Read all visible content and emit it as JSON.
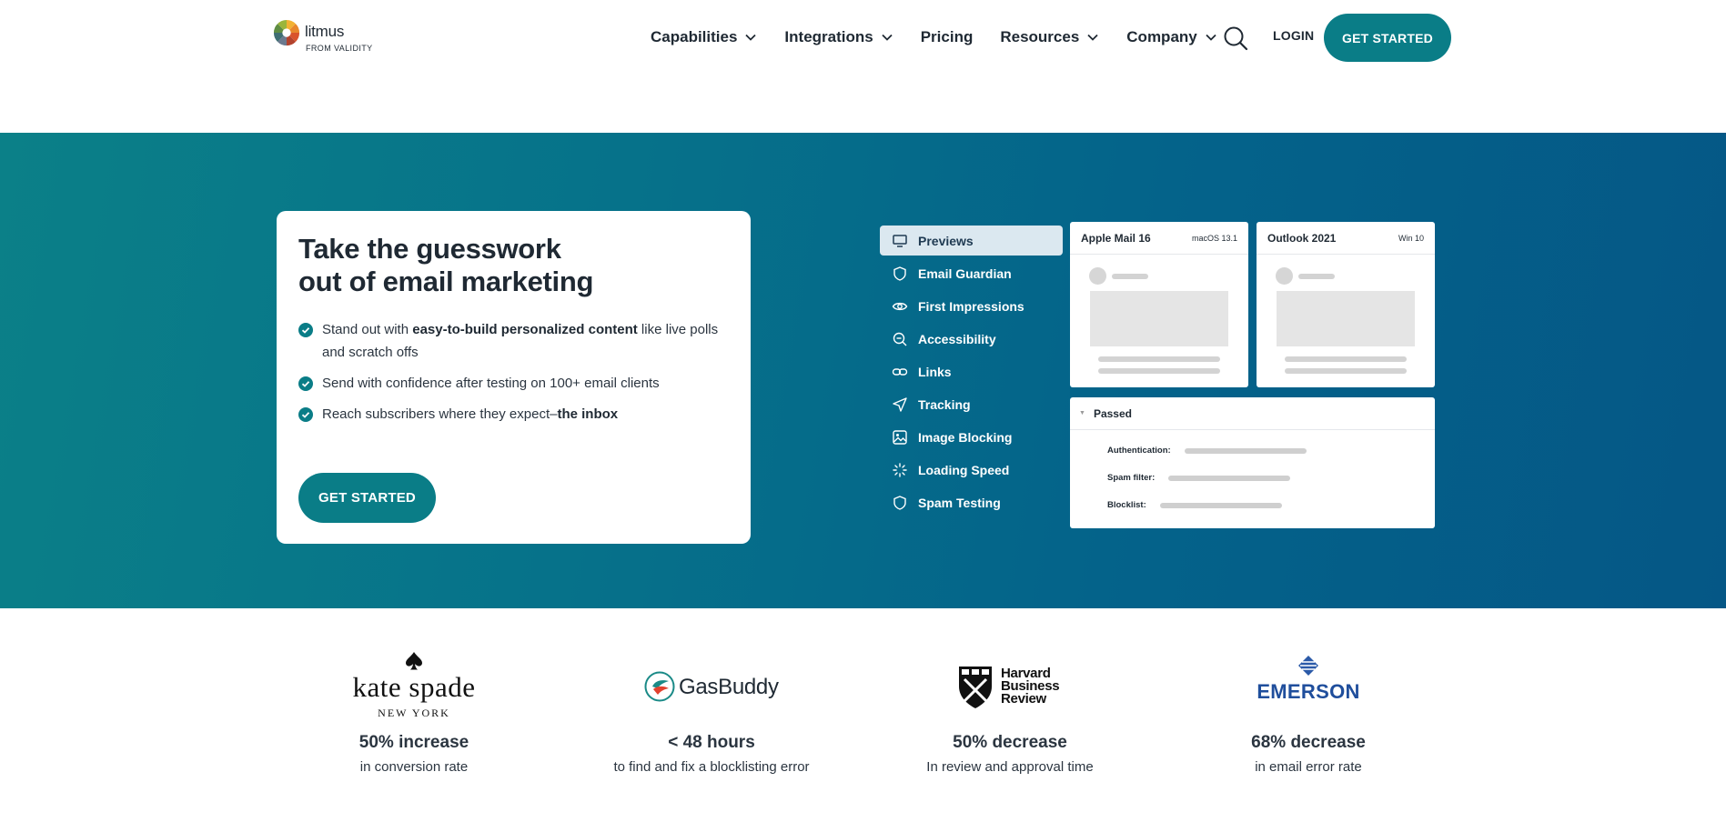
{
  "header": {
    "logo_word": "litmus",
    "logo_sub": "FROM VALIDITY",
    "nav": [
      {
        "label": "Capabilities",
        "has_dropdown": true
      },
      {
        "label": "Integrations",
        "has_dropdown": true
      },
      {
        "label": "Pricing",
        "has_dropdown": false
      },
      {
        "label": "Resources",
        "has_dropdown": true
      },
      {
        "label": "Company",
        "has_dropdown": true
      }
    ],
    "search_icon": "search-icon",
    "login_label": "LOGIN",
    "cta_label": "GET STARTED",
    "accent_color": "#0a7d87"
  },
  "hero": {
    "title_line1": "Take the guesswork",
    "title_line2": "out of email marketing",
    "bullet1_pre": "Stand out with ",
    "bullet1_bold": "easy-to-build personalized content",
    "bullet1_post": " like live polls and scratch offs",
    "bullet2": "Send with confidence after testing on 100+ email clients",
    "bullet3_pre": "Reach subscribers where they expect–",
    "bullet3_bold": "the inbox",
    "cta_label": "GET STARTED",
    "features": [
      {
        "label": "Previews",
        "icon": "monitor-icon",
        "active": true
      },
      {
        "label": "Email Guardian",
        "icon": "shield-icon",
        "active": false
      },
      {
        "label": "First Impressions",
        "icon": "eye-icon",
        "active": false
      },
      {
        "label": "Accessibility",
        "icon": "zoom-icon",
        "active": false
      },
      {
        "label": "Links",
        "icon": "link-icon",
        "active": false
      },
      {
        "label": "Tracking",
        "icon": "send-icon",
        "active": false
      },
      {
        "label": "Image Blocking",
        "icon": "image-icon",
        "active": false
      },
      {
        "label": "Loading Speed",
        "icon": "loader-icon",
        "active": false
      },
      {
        "label": "Spam Testing",
        "icon": "shield-icon",
        "active": false
      }
    ],
    "previews": [
      {
        "client": "Apple Mail 16",
        "os": "macOS 13.1"
      },
      {
        "client": "Outlook 2021",
        "os": "Win 10"
      }
    ],
    "spam": {
      "status": "Passed",
      "rows": [
        "Authentication:",
        "Spam filter:",
        "Blocklist:"
      ]
    }
  },
  "stats": [
    {
      "brand": "kate spade",
      "brand_sub": "NEW YORK",
      "headline": "50% increase",
      "detail": "in conversion rate"
    },
    {
      "brand": "GasBuddy",
      "headline": "< 48 hours",
      "detail": "to find and fix a blocklisting error"
    },
    {
      "brand_lines": [
        "Harvard",
        "Business",
        "Review"
      ],
      "headline": "50% decrease",
      "detail": "In review and approval time"
    },
    {
      "brand": "EMERSON",
      "headline": "68% decrease",
      "detail": "in email error rate"
    }
  ]
}
